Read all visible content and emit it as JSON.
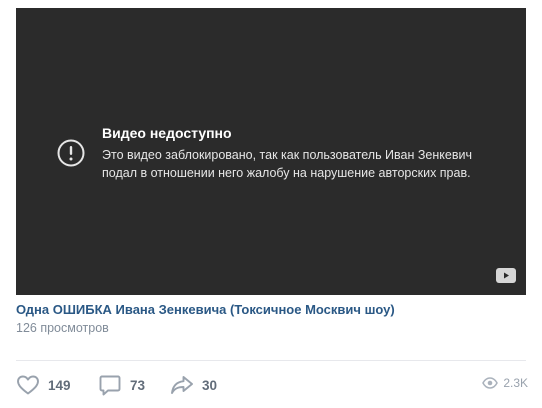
{
  "player": {
    "notice_title": "Видео недоступно",
    "notice_body": "Это видео заблокировано, так как пользователь Иван Зенкевич подал в отношении него жалобу на нарушение авторских прав.",
    "icons": {
      "alert": "exclamation-circle-icon",
      "source": "youtube-icon"
    }
  },
  "video": {
    "title": "Одна ОШИБКА Ивана Зенкевича (Токсичное Москвич шоу)",
    "views": "126 просмотров"
  },
  "actions": {
    "likes": "149",
    "comments": "73",
    "shares": "30",
    "views_short": "2.3K"
  },
  "colors": {
    "player_bg": "#2b2b2b",
    "link": "#2a5885",
    "muted": "#818c99",
    "action_icon": "#99a2ad"
  }
}
